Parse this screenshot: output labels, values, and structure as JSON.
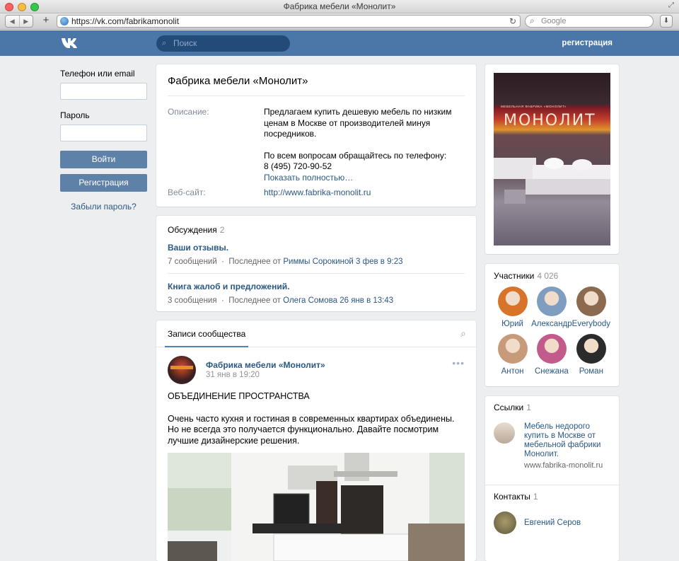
{
  "browser": {
    "window_title": "Фабрика мебели «Монолит»",
    "url": "https://vk.com/fabrikamonolit",
    "search_placeholder": "Google",
    "new_tab_label": "+"
  },
  "header": {
    "search_placeholder": "Поиск",
    "register_link": "регистрация"
  },
  "login": {
    "phone_label": "Телефон или email",
    "password_label": "Пароль",
    "login_button": "Войти",
    "register_button": "Регистрация",
    "forgot_link": "Забыли пароль?"
  },
  "community": {
    "name": "Фабрика мебели «Монолит»",
    "description_key": "Описание:",
    "description_p1": "Предлагаем купить дешевую мебель по низким ценам в Москве от производителей минуя посредников.",
    "description_p2": "По всем вопросам обращайтесь по телефону:",
    "phone": "8 (495) 720-90-52",
    "show_more": "Показать полностью…",
    "website_key": "Веб-сайт:",
    "website": "http://www.fabrika-monolit.ru"
  },
  "discussions": {
    "title": "Обсуждения",
    "count": "2",
    "topics": [
      {
        "title": "Ваши отзывы.",
        "messages": "7 сообщений",
        "sep": "·",
        "last_prefix": "Последнее от",
        "last_author": "Риммы Сорокиной",
        "last_date": "3 фев в 9:23"
      },
      {
        "title": "Книга жалоб и предложений.",
        "messages": "3 сообщения",
        "sep": "·",
        "last_prefix": "Последнее от",
        "last_author": "Олега Сомова",
        "last_date": "26 янв в 13:43"
      }
    ]
  },
  "posts": {
    "tab": "Записи сообщества",
    "author": "Фабрика мебели «Монолит»",
    "date": "31 янв в 19:20",
    "menu": "•••",
    "heading": "ОБЪЕДИНЕНИЕ ПРОСТРАНСТВА",
    "text": "Очень часто кухня и гостиная в современных квартирах объединены. Но не всегда это получается функционально. Давайте посмотрим лучшие дизайнерские решения."
  },
  "cover": {
    "brand_small": "МЕБЕЛЬНАЯ ФАБРИКА «МОНОЛИТ»",
    "brand_big": "МОНОЛИТ"
  },
  "members": {
    "title": "Участники",
    "count": "4 026",
    "people": [
      {
        "name": "Юрий",
        "color": "#d8742a"
      },
      {
        "name": "Александр",
        "color": "#7f9dbf"
      },
      {
        "name": "Everybody",
        "color": "#8b6a4f"
      },
      {
        "name": "Антон",
        "color": "#c79b7a"
      },
      {
        "name": "Снежана",
        "color": "#c35a8c"
      },
      {
        "name": "Роман",
        "color": "#2b2b2b"
      }
    ]
  },
  "links": {
    "title": "Ссылки",
    "count": "1",
    "item_text": "Мебель недорого купить в Москве от мебельной фабрики Монолит.",
    "item_url": "www.fabrika-monolit.ru"
  },
  "contacts": {
    "title": "Контакты",
    "count": "1",
    "name": "Евгений Серов"
  },
  "colors": {
    "header": "#4a76a8",
    "link": "#2a5885",
    "button": "#5e81a8",
    "page_bg": "#edeef0"
  }
}
